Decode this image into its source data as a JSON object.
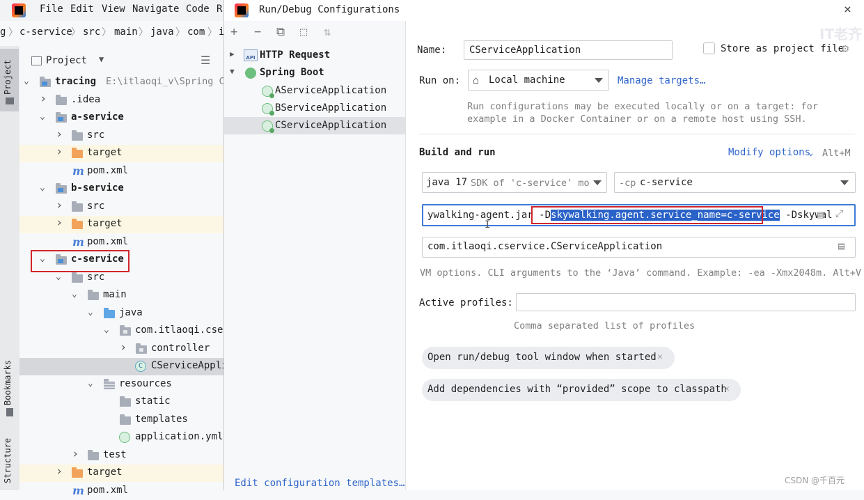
{
  "menubar": {
    "items": [
      "File",
      "Edit",
      "View",
      "Navigate",
      "Code",
      "R"
    ]
  },
  "breadcrumb": [
    "g",
    "c-service",
    "src",
    "main",
    "java",
    "com",
    "i"
  ],
  "left_strip": {
    "project": "Project",
    "bookmarks": "Bookmarks",
    "structure": "Structure"
  },
  "project_panel": {
    "title": "Project",
    "tree": [
      {
        "label": "tracing",
        "hint": "E:\\itlaoqi_v\\Spring C",
        "bold": true
      },
      {
        "label": ".idea"
      },
      {
        "label": "a-service",
        "bold": true
      },
      {
        "label": "src"
      },
      {
        "label": "target"
      },
      {
        "label": "pom.xml"
      },
      {
        "label": "b-service",
        "bold": true
      },
      {
        "label": "src"
      },
      {
        "label": "target"
      },
      {
        "label": "pom.xml"
      },
      {
        "label": "c-service",
        "bold": true
      },
      {
        "label": "src"
      },
      {
        "label": "main"
      },
      {
        "label": "java"
      },
      {
        "label": "com.itlaoqi.cser"
      },
      {
        "label": "controller"
      },
      {
        "label": "CServiceAppli"
      },
      {
        "label": "resources"
      },
      {
        "label": "static"
      },
      {
        "label": "templates"
      },
      {
        "label": "application.yml"
      },
      {
        "label": "test"
      },
      {
        "label": "target"
      },
      {
        "label": "pom.xml"
      }
    ]
  },
  "dialog": {
    "title": "Run/Debug Configurations",
    "close": "×",
    "toolbar": [
      "+",
      "−",
      "⧉",
      "⬚",
      "⇅"
    ],
    "list": [
      {
        "label": "HTTP Request",
        "bold": true
      },
      {
        "label": "Spring Boot",
        "bold": true
      },
      {
        "label": "AServiceApplication"
      },
      {
        "label": "BServiceApplication"
      },
      {
        "label": "CServiceApplication",
        "selected": true
      }
    ],
    "edit_templates": "Edit configuration templates…",
    "name_label": "Name:",
    "name_value": "CServiceApplication",
    "store_label": "Store as project file",
    "run_on_label": "Run on:",
    "run_on_value": "Local machine",
    "manage_targets": "Manage targets…",
    "run_hint_1": "Run configurations may be executed locally or on a target: for",
    "run_hint_2": "example in a Docker Container or on a remote host using SSH.",
    "build_run": "Build and run",
    "modify_options": "Modify options",
    "modify_shortcut": "Alt+M",
    "jdk_value": "java 17",
    "jdk_hint": "SDK of 'c-service' mo",
    "cp_prefix": "-cp",
    "cp_value": "c-service",
    "vm_before": "ywalking-agent.jar -D",
    "vm_selected": "skywalking.agent.service_name=c-service",
    "vm_after": " -Dskywal",
    "main_class": "com.itlaoqi.cservice.CServiceApplication",
    "vm_hint": "VM options. CLI arguments to the ‘Java’ command. Example: -ea -Xmx2048m. Alt+V",
    "profiles_label": "Active profiles:",
    "profiles_hint": "Comma separated list of profiles",
    "chip1": "Open run/debug tool window when started",
    "chip2": "Add dependencies with “provided” scope to classpath"
  },
  "watermark": "CSDN @千百元",
  "watermark_top": "IT老齐"
}
